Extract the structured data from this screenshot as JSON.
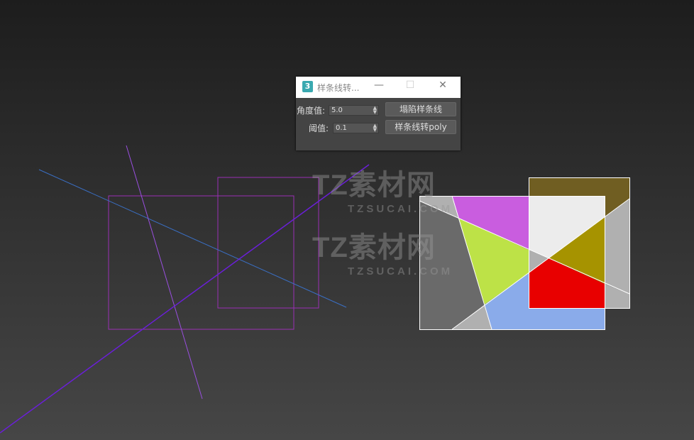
{
  "watermark": {
    "brand": "TZ素材网",
    "url": "TZSUCAI.COM"
  },
  "dialog": {
    "app_icon": "3",
    "title": "样条线转...",
    "minimize": "—",
    "maximize": "☐",
    "close": "✕",
    "angle_label": "角度值:",
    "angle_value": "5.0",
    "threshold_label": "阈值:",
    "threshold_value": "0.1",
    "collapse_button": "塌陷样条线",
    "convert_button": "样条线转poly"
  },
  "colors": {
    "magenta": "#c95ddf",
    "lime": "#bde247",
    "gray_dark": "#6a6a6a",
    "gray_light": "#b0b0b0",
    "blue": "#8aabea",
    "white": "#ececec",
    "olive": "#a69300",
    "olive_dark": "#705e22",
    "red": "#e80000"
  }
}
